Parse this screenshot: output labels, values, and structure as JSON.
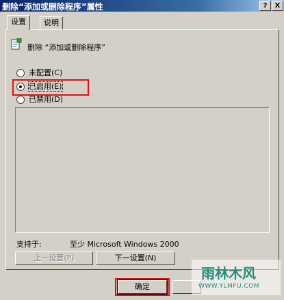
{
  "window": {
    "title": "删除“添加或删除程序”属性",
    "help_button": "?",
    "close_button": "X"
  },
  "tabs": [
    {
      "label": "设置"
    },
    {
      "label": "说明"
    }
  ],
  "policy": {
    "name": "删除 “添加或删除程序”"
  },
  "options": {
    "not_configured": "未配置(C)",
    "enabled": "已启用(E)",
    "disabled": "已禁用(D)",
    "selected": "enabled"
  },
  "supported": {
    "label": "支持于:",
    "value": "至少 Microsoft Windows 2000"
  },
  "nav": {
    "prev": "上一设置(P)",
    "next": "下一设置(N)"
  },
  "footer": {
    "ok": "确定"
  },
  "watermark": {
    "text": "雨林木风",
    "url": "WWW.YLMFU.COM"
  },
  "colors": {
    "highlight": "#e01010",
    "titlebar": "#0a246a"
  }
}
